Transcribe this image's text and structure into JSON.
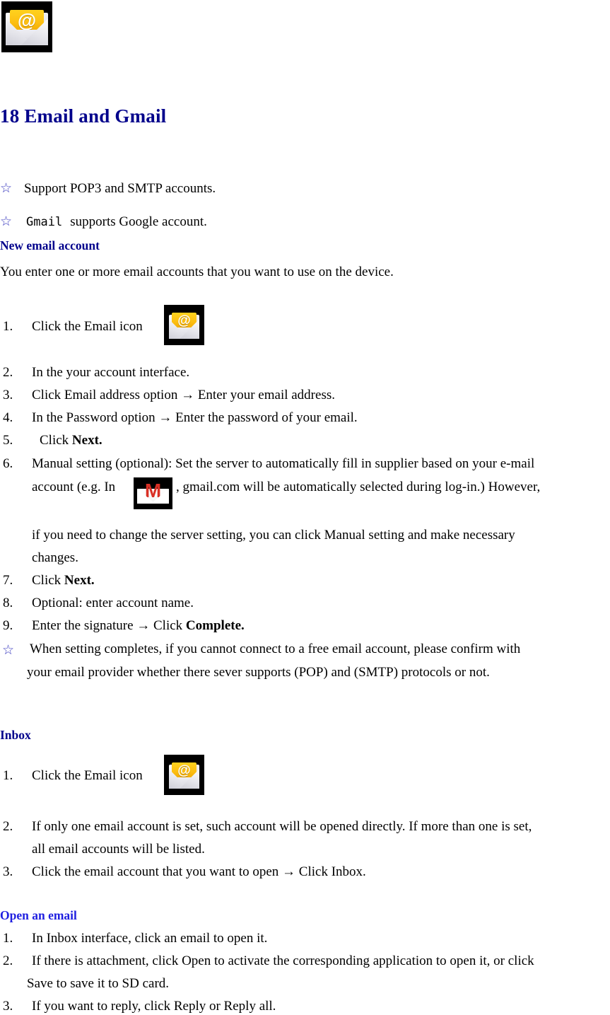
{
  "document": {
    "title": "18 Email and Gmail",
    "app_icon": {
      "name": "email-app-icon",
      "glyph": "@"
    },
    "gmail_icon": {
      "name": "gmail-app-icon",
      "glyph": "M"
    },
    "colors": {
      "heading_navy": "#00008b",
      "heading_bright_blue": "#1f1fe0",
      "star_blue": "#3b3bbf",
      "icon_background": "#000000",
      "icon_card_gold": "#fcbe12",
      "gmail_red": "#d93025",
      "body_text": "#000000",
      "page_background": "#ffffff"
    },
    "bullets": {
      "star_glyph": "☆",
      "arrow_glyph": "→"
    },
    "intro_bullets": [
      {
        "star": "☆",
        "text": "Support POP3 and    SMTP accounts."
      },
      {
        "star": "☆",
        "mono": "Gmail",
        "text": "supports Google account."
      }
    ],
    "sections": [
      {
        "heading": "New email account",
        "heading_style": "navy",
        "lead": "You enter one or more email accounts that you want to use on the device.",
        "items": [
          {
            "num": "1.",
            "text": "Click the Email icon",
            "icon": "email-app-icon"
          },
          {
            "num": "2.",
            "text": "In the your account interface."
          },
          {
            "num": "3.",
            "text": "Click Email address option → Enter your email address."
          },
          {
            "num": "4.",
            "text": "In the Password option → Enter the password of your email."
          },
          {
            "num": "5.",
            "text": "Click ",
            "bold": "Next."
          },
          {
            "num": "6.",
            "line1": "Manual setting (optional): Set the server to automatically fill in supplier based on your e-mail",
            "line2_pre": "account (e.g. In",
            "icon": "gmail-app-icon",
            "line2_post": ", gmail.com will be automatically selected during log-in.) However,",
            "line3": "if you need to change the server setting, you can click Manual setting and make necessary",
            "line4": "changes."
          },
          {
            "num": "7.",
            "text": "Click ",
            "bold": "Next."
          },
          {
            "num": "8.",
            "text": "Optional: enter account name."
          },
          {
            "num": "9.",
            "text": "Enter the signature → Click ",
            "bold": "Complete."
          }
        ],
        "note": {
          "star": "☆",
          "line1": "When setting completes, if you cannot connect to a free email account, please confirm with",
          "line2": "your email provider whether there sever supports (POP) and (SMTP) protocols or not."
        }
      },
      {
        "heading": "Inbox",
        "heading_style": "navy",
        "items": [
          {
            "num": "1.",
            "text": "Click the Email icon",
            "icon": "email-app-icon"
          },
          {
            "num": "2.",
            "line1": "If only one email account is set, such account will be opened directly. If more than one is set,",
            "line2": "all email accounts will be listed."
          },
          {
            "num": "3.",
            "text": "Click the email account that you want to open → Click Inbox."
          }
        ]
      },
      {
        "heading": "Open an email",
        "heading_style": "bright",
        "items": [
          {
            "num": "1.",
            "text": "In Inbox interface, click an email to open it."
          },
          {
            "num": "2.",
            "line1": "If there is attachment, click Open to activate the corresponding application to open it, or click",
            "line2": "Save to save it to SD card."
          },
          {
            "num": "3.",
            "text": "If you want to reply, click Reply or Reply all."
          }
        ]
      }
    ]
  }
}
